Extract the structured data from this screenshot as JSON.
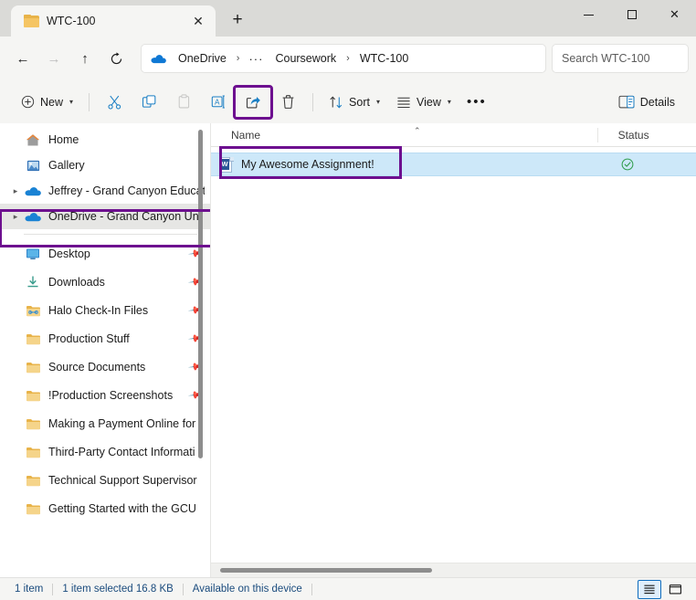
{
  "window": {
    "tab": {
      "title": "WTC-100",
      "icon": "folder-icon",
      "close_label": "✕"
    },
    "new_tab_label": "+",
    "controls": {
      "minimize": "minimize-icon",
      "maximize": "maximize-icon",
      "close": "✕"
    }
  },
  "nav": {
    "back": "←",
    "forward": "→",
    "up": "↑",
    "refresh": "⟳",
    "breadcrumb": {
      "root": "OneDrive",
      "ellipsis": "···",
      "items": [
        "Coursework",
        "WTC-100"
      ],
      "separator": "›"
    },
    "search": {
      "placeholder": "Search WTC-100",
      "value": ""
    }
  },
  "toolbar": {
    "new_label": "New",
    "cut_label": "Cut",
    "copy_label": "Copy",
    "paste_label": "Paste",
    "rename_label": "Rename",
    "share_label": "Share",
    "delete_label": "Delete",
    "sort_label": "Sort",
    "view_label": "View",
    "more_label": "•••",
    "details_label": "Details",
    "chevron": "▾",
    "highlight_color": "#6d0f8f",
    "accent_color": "#0f6cbd"
  },
  "sidebar": {
    "items": [
      {
        "label": "Home",
        "icon": "home-icon",
        "expander": false,
        "pinned": false,
        "selected": false
      },
      {
        "label": "Gallery",
        "icon": "gallery-icon",
        "expander": false,
        "pinned": false,
        "selected": false
      },
      {
        "label": "Jeffrey - Grand Canyon Educat",
        "icon": "onedrive-cloud-icon",
        "expander": true,
        "pinned": false,
        "selected": false
      },
      {
        "label": "OneDrive - Grand Canyon Uni",
        "icon": "onedrive-cloud-icon",
        "expander": true,
        "pinned": false,
        "selected": true
      },
      {
        "divider": true
      },
      {
        "label": "Desktop",
        "icon": "desktop-icon",
        "expander": false,
        "pinned": true,
        "selected": false
      },
      {
        "label": "Downloads",
        "icon": "downloads-icon",
        "expander": false,
        "pinned": true,
        "selected": false
      },
      {
        "label": "Halo Check-In Files",
        "icon": "folder-link-icon",
        "expander": false,
        "pinned": true,
        "selected": false
      },
      {
        "label": "Production Stuff",
        "icon": "folder-icon",
        "expander": false,
        "pinned": true,
        "selected": false
      },
      {
        "label": "Source Documents",
        "icon": "folder-icon",
        "expander": false,
        "pinned": true,
        "selected": false
      },
      {
        "label": "!Production Screenshots",
        "icon": "folder-icon",
        "expander": false,
        "pinned": true,
        "selected": false
      },
      {
        "label": "Making a Payment Online for",
        "icon": "folder-icon",
        "expander": false,
        "pinned": false,
        "selected": false
      },
      {
        "label": "Third-Party Contact Informati",
        "icon": "folder-icon",
        "expander": false,
        "pinned": false,
        "selected": false
      },
      {
        "label": "Technical Support Supervisor ",
        "icon": "folder-icon",
        "expander": false,
        "pinned": false,
        "selected": false
      },
      {
        "label": "Getting Started with the GCU ",
        "icon": "folder-icon",
        "expander": false,
        "pinned": false,
        "selected": false
      }
    ],
    "pin_glyph": "📌"
  },
  "filelist": {
    "columns": [
      {
        "key": "name",
        "label": "Name",
        "sorted": "asc",
        "sort_glyph": "⌃"
      },
      {
        "key": "status",
        "label": "Status",
        "sorted": null
      }
    ],
    "rows": [
      {
        "name": "My Awesome Assignment!",
        "icon": "word-document-icon",
        "status_icon": "cloud-available-check-icon",
        "selected": true,
        "highlighted": true
      }
    ]
  },
  "statusbar": {
    "item_count": "1 item",
    "selection": "1 item selected  16.8 KB",
    "availability": "Available on this device",
    "view_details_label": "Details view",
    "view_large_icons_label": "Large icons view"
  }
}
